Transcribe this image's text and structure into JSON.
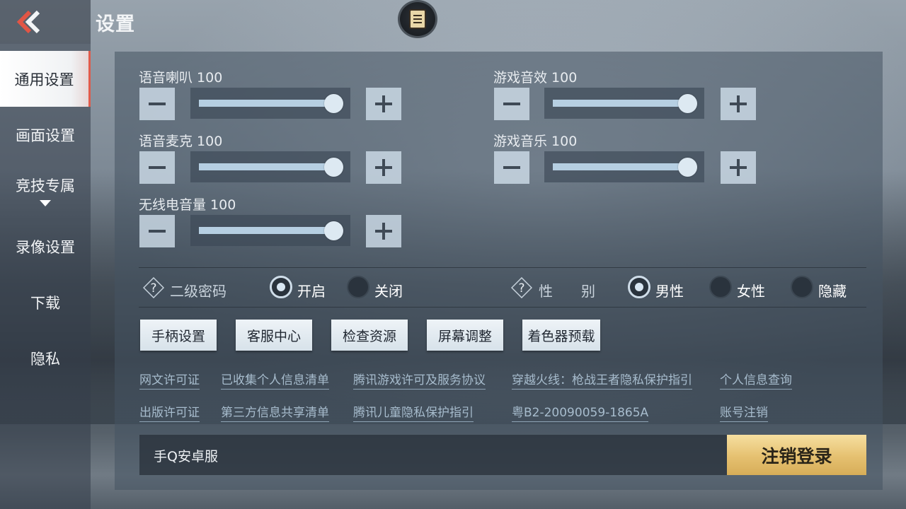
{
  "header": {
    "title": "设置",
    "back_icon": "double-chevron-left-icon",
    "notice_icon": "scroll-notice-icon"
  },
  "sidebar": {
    "items": [
      {
        "label": "通用设置",
        "active": true
      },
      {
        "label": "画面设置"
      },
      {
        "label": "竞技专属",
        "has_dropdown": true
      },
      {
        "label": "录像设置"
      },
      {
        "label": "下载"
      },
      {
        "label": "隐私"
      }
    ]
  },
  "volume": {
    "voice_speaker": {
      "label": "语音喇叭",
      "value": "100",
      "level": 1.0
    },
    "game_sfx": {
      "label": "游戏音效",
      "value": "100",
      "level": 1.0
    },
    "voice_mic": {
      "label": "语音麦克",
      "value": "100",
      "level": 1.0
    },
    "game_music": {
      "label": "游戏音乐",
      "value": "100",
      "level": 1.0
    },
    "radio": {
      "label": "无线电音量",
      "value": "100",
      "level": 1.0
    }
  },
  "options": {
    "secondary_password": {
      "label": "二级密码",
      "on_label": "开启",
      "off_label": "关闭",
      "selected": "开启"
    },
    "gender": {
      "label": "性　　别",
      "male": "男性",
      "female": "女性",
      "hidden": "隐藏",
      "selected": "男性"
    }
  },
  "actions": [
    "手柄设置",
    "客服中心",
    "检查资源",
    "屏幕调整",
    "着色器预载"
  ],
  "links": {
    "row1": [
      "网文许可证",
      "已收集个人信息清单",
      "腾讯游戏许可及服务协议",
      "穿越火线：枪战王者隐私保护指引",
      "个人信息查询"
    ],
    "row2": [
      "出版许可证",
      "第三方信息共享清单",
      "腾讯儿童隐私保护指引",
      "粤B2-20090059-1865A",
      "账号注销"
    ]
  },
  "account": {
    "server": "手Q安卓服",
    "logout": "注销登录"
  },
  "colors": {
    "accent_red": "#e05b4b",
    "logout_gold": "#e5c070",
    "link_blue": "#a7bccd"
  }
}
